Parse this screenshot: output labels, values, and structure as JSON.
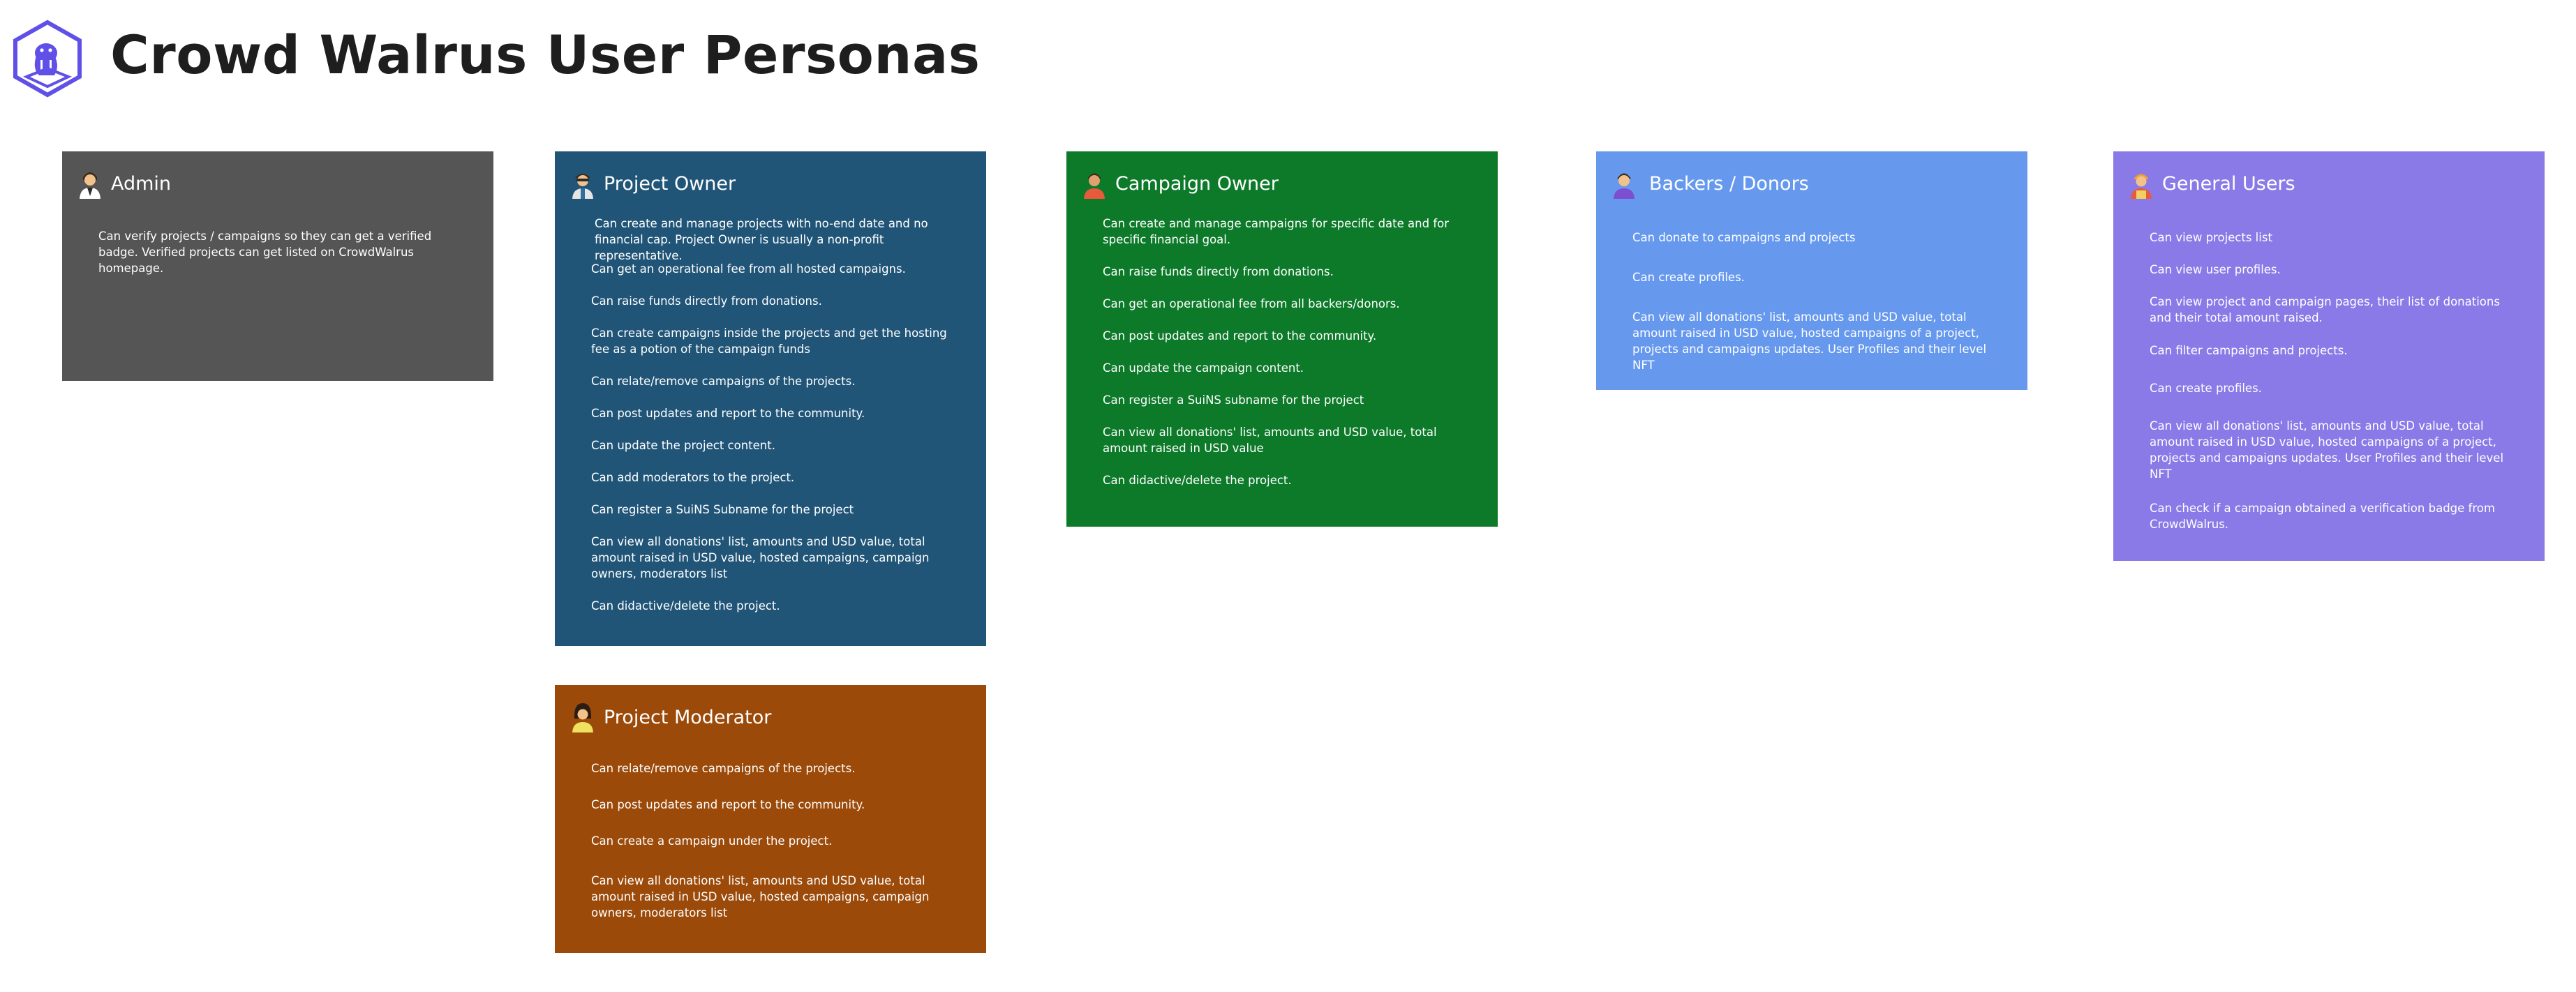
{
  "title": "Crowd Walrus User Personas",
  "colors": {
    "admin": "#555555",
    "project_owner": "#215578",
    "campaign_owner": "#0d7a2a",
    "backers": "#6699ee",
    "general": "#8a7ae8",
    "moderator": "#9b4a0a",
    "logo": "#6050e8"
  },
  "personas": {
    "admin": {
      "title": "Admin",
      "icon": "admin-avatar-icon",
      "items": [
        "Can verify projects / campaigns so they can get a verified badge. Verified projects can get listed on CrowdWalrus homepage."
      ]
    },
    "project_owner": {
      "title": "Project Owner",
      "icon": "project-owner-avatar-icon",
      "items": [
        "Can create and manage projects with no-end date and no financial cap. Project Owner is usually a non-profit representative.",
        "Can get an operational fee from all hosted campaigns.",
        "Can raise funds directly from donations.",
        "Can create campaigns inside the projects and get the hosting fee as a potion of the campaign funds",
        "Can relate/remove campaigns of the projects.",
        "Can post updates and report to the community.",
        "Can update the project content.",
        "Can add moderators to the project.",
        "Can register a SuiNS Subname for the project",
        "Can view all donations' list, amounts and USD value, total amount raised in USD value, hosted campaigns, campaign owners, moderators list",
        "Can didactive/delete the project."
      ]
    },
    "campaign_owner": {
      "title": "Campaign Owner",
      "icon": "campaign-owner-avatar-icon",
      "items": [
        "Can create and manage campaigns for specific date and for specific financial goal.",
        "Can raise funds directly from donations.",
        "Can get an operational fee from all backers/donors.",
        "Can post updates and report to the community.",
        "Can update the campaign content.",
        "Can register a SuiNS subname for the project",
        "Can view all donations' list, amounts and USD value, total amount raised in USD value",
        "Can didactive/delete the project."
      ]
    },
    "backers": {
      "title": "Backers / Donors",
      "icon": "backer-avatar-icon",
      "items": [
        "Can donate to campaigns and projects",
        "Can create profiles.",
        "Can view all donations' list, amounts and USD value, total amount raised in USD value, hosted campaigns of a project, projects and campaigns  updates. User Profiles and their level NFT"
      ]
    },
    "general": {
      "title": "General Users",
      "icon": "general-user-avatar-icon",
      "items": [
        "Can view projects list",
        "Can view user profiles.",
        "Can view project and campaign pages, their list of donations and their total amount raised.",
        "Can filter campaigns and projects.",
        "Can create profiles.",
        "Can view all donations' list, amounts and USD value, total amount raised in USD value, hosted campaigns of a project, projects and campaigns  updates. User Profiles and their level NFT",
        "Can check if a campaign obtained a verification badge from CrowdWalrus."
      ]
    },
    "moderator": {
      "title": "Project Moderator",
      "icon": "moderator-avatar-icon",
      "items": [
        "Can relate/remove campaigns of the projects.",
        "Can post updates and report to the community.",
        "Can create a campaign under the project.",
        "Can view all donations' list, amounts and USD value, total amount raised in USD value, hosted campaigns, campaign owners, moderators list"
      ]
    }
  }
}
